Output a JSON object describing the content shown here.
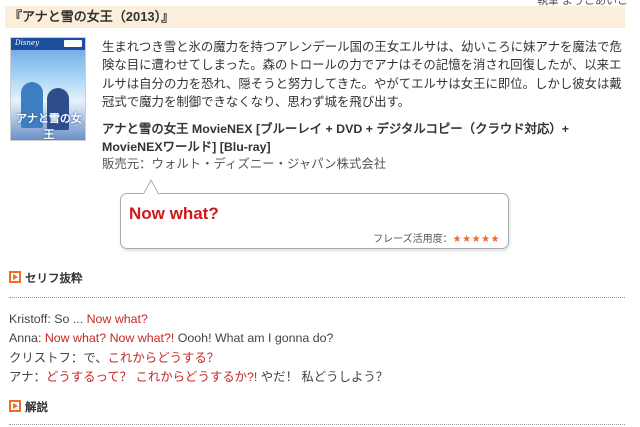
{
  "author_cut": "執筆 ようこあいこ",
  "title": "『アナと雪の女王（2013）』",
  "cover": {
    "brand": "Disney",
    "title": "アナと雪の女王"
  },
  "description": "生まれつき雪と氷の魔力を持つアレンデール国の王女エルサは、幼いころに妹アナを魔法で危険な目に遭わせてしまった。森のトロールの力でアナはその記憶を消され回復したが、以来エルサは自分の力を恐れ、隠そうと努力してきた。やがてエルサは女王に即位。しかし彼女は戴冠式で魔力を制御できなくなり、思わず城を飛び出す。",
  "product": {
    "title": "アナと雪の女王 MovieNEX [ブルーレイ + DVD + デジタルコピー（クラウド対応）+ MovieNEXワールド] [Blu-ray]",
    "seller": "販売元：ウォルト・ディズニー・ジャパン株式会社"
  },
  "phrase_box": {
    "phrase": "Now what?",
    "rating_label": "フレーズ活用度：",
    "rating_stars": "★★★★★",
    "rating_value": 5
  },
  "serif_section": {
    "heading": "セリフ抜粋"
  },
  "dialogue": [
    {
      "speaker": "Kristoff: ",
      "text": "So ... ",
      "highlight": "Now what?",
      "after": ""
    },
    {
      "speaker": "Anna: ",
      "text": "",
      "highlight": "Now what? Now what?!",
      "after": " Oooh! What am I gonna do?"
    },
    {
      "speaker": "クリストフ：",
      "text": "で、",
      "highlight": "これからどうする？",
      "after": ""
    },
    {
      "speaker": "アナ：",
      "text": "",
      "highlight": "どうするって？ これからどうするか?!",
      "after": " やだ！ 私どうしよう？"
    }
  ],
  "commentary_section": {
    "heading": "解説"
  },
  "colors": {
    "title_bg": "#fbefdb",
    "highlight_red": "#c62828",
    "accent_orange": "#ec6c2b"
  }
}
